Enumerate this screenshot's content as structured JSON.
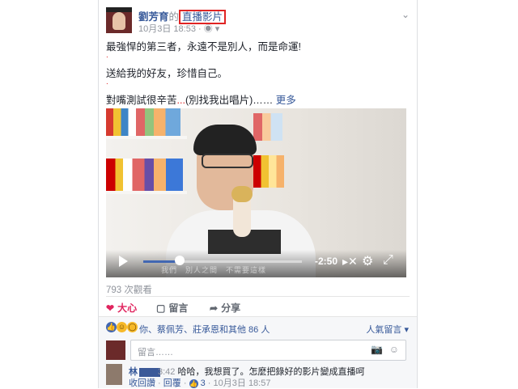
{
  "post": {
    "author": "劉芳育",
    "possessive": "的",
    "type_label": "直播影片",
    "date": "10月3日 18:53",
    "privacy_sep": "·",
    "privacy_icon": "globe-icon",
    "text_lines": [
      "最強悍的第三者，永遠不是別人，而是命運!",
      "送給我的好友，珍惜自己。",
      "對嘴測試很辛苦",
      "...",
      "(別找我出唱片)……",
      "更多"
    ]
  },
  "video": {
    "time_remaining": "-2:50",
    "progress_fraction": 0.23,
    "subtitle": "我們　別人之間　不需要這樣"
  },
  "stats": {
    "views": "793 次觀看"
  },
  "actions": {
    "love": "大心",
    "comment": "留言",
    "share": "分享"
  },
  "reactions": {
    "summary": "你、蔡佩芳、莊承恩和其他 86 人",
    "popular": "人氣留言"
  },
  "comment_box": {
    "placeholder": "留言……"
  },
  "comment": {
    "name": "林",
    "time_inline": "3:42",
    "text": "哈哈，我想買了。怎麼把錄好的影片變成直播呵",
    "undo_like": "收回讚",
    "reply": "回覆",
    "like_count": "3",
    "date": "10月3日 18:57"
  },
  "colors": {
    "link": "#365899",
    "love": "#e0245e",
    "highlight_box": "#e02424"
  }
}
